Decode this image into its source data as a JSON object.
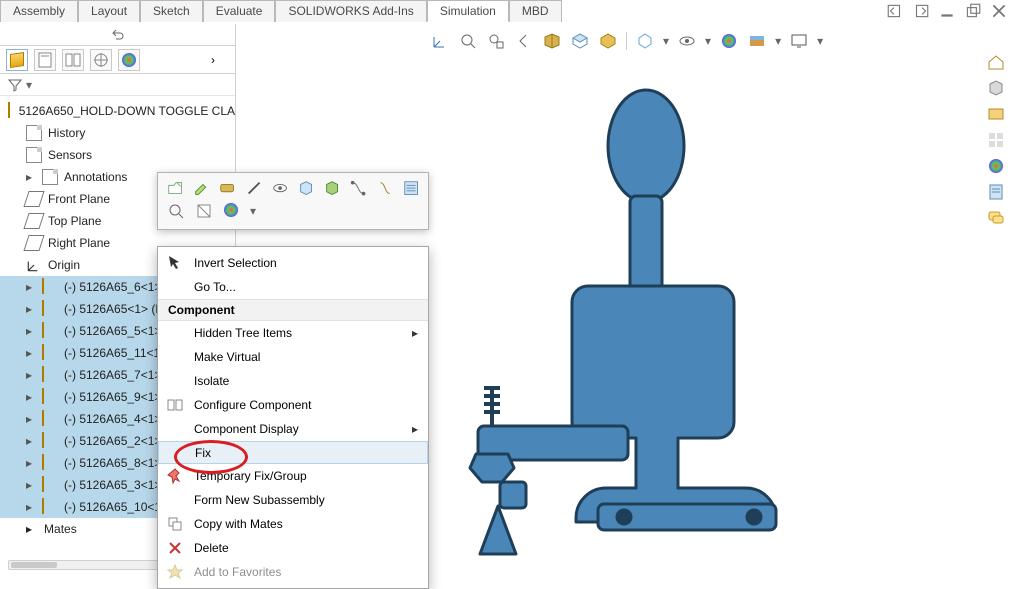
{
  "cmd_tabs": {
    "items": [
      "Assembly",
      "Layout",
      "Sketch",
      "Evaluate",
      "SOLIDWORKS Add-Ins",
      "Simulation",
      "MBD"
    ],
    "active": 5
  },
  "tree": {
    "root": "5126A650_HOLD-DOWN TOGGLE CLA",
    "system": [
      "History",
      "Sensors",
      "Annotations",
      "Front Plane",
      "Top Plane",
      "Right Plane",
      "Origin"
    ],
    "components": [
      "(-) 5126A65_6<1> (",
      "(-) 5126A65<1> (De",
      "(-) 5126A65_5<1> (",
      "(-) 5126A65_11<1>",
      "(-) 5126A65_7<1> (",
      "(-) 5126A65_9<1> (",
      "(-) 5126A65_4<1> (",
      "(-) 5126A65_2<1> (",
      "(-) 5126A65_8<1> (",
      "(-) 5126A65_3<1> (",
      "(-) 5126A65_10<1>"
    ],
    "mates": "Mates"
  },
  "ctx_menu": {
    "invert": "Invert Selection",
    "goto": "Go To...",
    "header": "Component",
    "hidden": "Hidden Tree Items",
    "make_virtual": "Make Virtual",
    "isolate": "Isolate",
    "configure": "Configure Component",
    "comp_display": "Component Display",
    "fix": "Fix",
    "temp_fix": "Temporary Fix/Group",
    "form_sub": "Form New Subassembly",
    "copy_mates": "Copy with Mates",
    "delete": "Delete",
    "favorites": "Add to Favorites"
  }
}
